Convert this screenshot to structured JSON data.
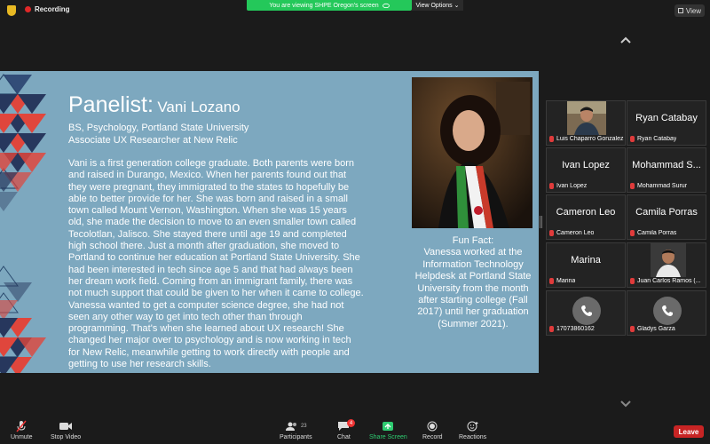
{
  "topbar": {
    "recording_label": "Recording",
    "share_banner": "You are viewing SHPE Oregon's screen",
    "view_options_label": "View Options",
    "view_button_label": "View"
  },
  "slide": {
    "title_prefix": "Panelist:",
    "title_name": "Vani Lozano",
    "degree": "BS, Psychology, Portland State University",
    "role": "Associate UX Researcher at New Relic",
    "bio": "Vani is a first generation college graduate. Both parents were born and raised in Durango, Mexico. When her parents found out that they were pregnant, they immigrated to the states to hopefully be able to better provide for her. She was born and raised in a small town called Mount Vernon, Washington. When she was 15 years old, she made the decision to move to an even smaller town called Tecolotlan, Jalisco. She stayed there until age 19 and completed high school there. Just a month after graduation, she moved to Portland to continue her education at Portland State University. She had been interested in tech since age 5 and that had always been her dream work field. Coming from an immigrant family, there was not much support that could be given to her when it came to college. Vanessa wanted to get a computer science degree, she had not seen any other way to get into tech other than through programming. That's when she learned about UX research! She changed her major over to psychology and is now working in tech for New Relic, meanwhile getting to work directly with people and getting to use her research skills.",
    "fun_fact_title": "Fun Fact:",
    "fun_fact": "Vanessa worked at the Information Technology Helpdesk at Portland State University from the month after starting college (Fall 2017) until her graduation (Summer 2021)."
  },
  "gallery": [
    {
      "big": "",
      "label": "Luis Chaparro Gonzalez",
      "type": "video",
      "muted": true
    },
    {
      "big": "Ryan Catabay",
      "label": "Ryan Catabay",
      "type": "name",
      "muted": true
    },
    {
      "big": "Ivan Lopez",
      "label": "Ivan Lopez",
      "type": "name",
      "muted": true
    },
    {
      "big": "Mohammad S...",
      "label": "Mohammad Surur",
      "type": "name",
      "muted": true
    },
    {
      "big": "Cameron Leo",
      "label": "Cameron Leo",
      "type": "name",
      "muted": true
    },
    {
      "big": "Camila Porras",
      "label": "Camila Porras",
      "type": "name",
      "muted": true
    },
    {
      "big": "Marina",
      "label": "Marina",
      "type": "name",
      "muted": true
    },
    {
      "big": "",
      "label": "Juan Carlos Ramos (...",
      "type": "video",
      "muted": true
    },
    {
      "big": "",
      "label": "17073860162",
      "type": "phone",
      "muted": true
    },
    {
      "big": "",
      "label": "Gladys Garza",
      "type": "phone",
      "muted": true
    }
  ],
  "toolbar": {
    "unmute": "Unmute",
    "stop_video": "Stop Video",
    "participants": "Participants",
    "participants_count": "23",
    "chat": "Chat",
    "chat_badge": "4",
    "share_screen": "Share Screen",
    "record": "Record",
    "reactions": "Reactions",
    "leave": "Leave"
  },
  "colors": {
    "slide_bg": "#7da8bf",
    "share_green": "#24c85a",
    "leave_red": "#c72424",
    "deco_red": "#e0463c",
    "deco_navy": "#27375d"
  }
}
